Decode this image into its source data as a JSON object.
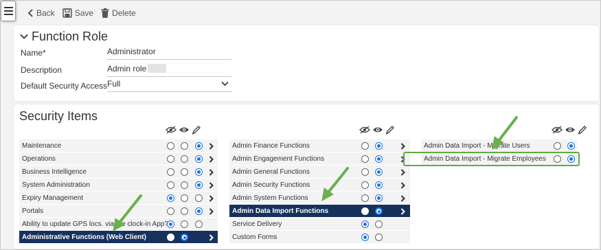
{
  "toolbar": {
    "back_label": "Back",
    "save_label": "Save",
    "delete_label": "Delete"
  },
  "function_role": {
    "title": "Function Role",
    "fields": [
      {
        "label": "Name*",
        "value": "Administrator"
      },
      {
        "label": "Description",
        "value": "Admin role"
      },
      {
        "label": "Default Security Access",
        "value": "Full"
      }
    ]
  },
  "security": {
    "title": "Security Items",
    "column_icons": [
      "hidden-icon",
      "view-icon",
      "edit-icon"
    ],
    "columns": [
      {
        "rows": [
          {
            "label": "Maintenance",
            "selected": 2,
            "active": false
          },
          {
            "label": "Operations",
            "selected": 2,
            "active": false
          },
          {
            "label": "Business Intelligence",
            "selected": 2,
            "active": false
          },
          {
            "label": "System Administration",
            "selected": 2,
            "active": false
          },
          {
            "label": "Expiry Management",
            "selected": 0,
            "active": false
          },
          {
            "label": "Portals",
            "selected": 2,
            "active": false
          },
          {
            "label": "Ability to update GPS locs. via the clock-in App?",
            "selected": 0,
            "active": false
          },
          {
            "label": "Administrative Functions (Web Client)",
            "selected": 1,
            "active": true
          }
        ]
      },
      {
        "rows": [
          {
            "label": "Admin Finance Functions",
            "selected": 1,
            "active": false
          },
          {
            "label": "Admin Engagement Functions",
            "selected": 1,
            "active": false
          },
          {
            "label": "Admin General Functions",
            "selected": 1,
            "active": false
          },
          {
            "label": "Admin Security Functions",
            "selected": 1,
            "active": false
          },
          {
            "label": "Admin System Functions",
            "selected": 1,
            "active": false
          },
          {
            "label": "Admin Data Import Functions",
            "selected": 1,
            "active": true
          },
          {
            "label": "Service Delivery",
            "selected": 0,
            "active": false
          },
          {
            "label": "Custom Forms",
            "selected": 0,
            "active": false
          }
        ]
      },
      {
        "rows": [
          {
            "label": "Admin Data Import - Migrate Users",
            "selected": 1,
            "active": false
          },
          {
            "label": "Admin Data Import - Migrate Employees",
            "selected": 1,
            "active": false
          }
        ]
      }
    ]
  },
  "colors": {
    "active_row": "#16325c",
    "radio_selected": "#1a73e8",
    "annotation_green": "#6ab04c"
  }
}
